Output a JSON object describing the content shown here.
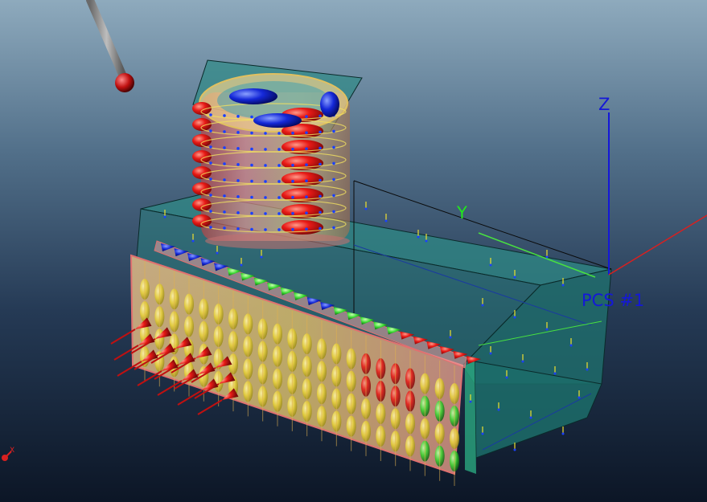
{
  "viewport": {
    "axis_labels": {
      "z": "Z",
      "y": "Y",
      "coordinate_system": "PCS #1"
    },
    "mini_triad": {
      "x": "X"
    },
    "colors": {
      "axis_z": "#1418d8",
      "axis_y": "#22e81c",
      "axis_x": "#d82020",
      "block_fill": "#1f7f7a",
      "plate_fill": "#f2a0a0",
      "max_stress": "#e01818",
      "min_stress": "#1020d0",
      "mid_stress": "#e8e030"
    }
  }
}
